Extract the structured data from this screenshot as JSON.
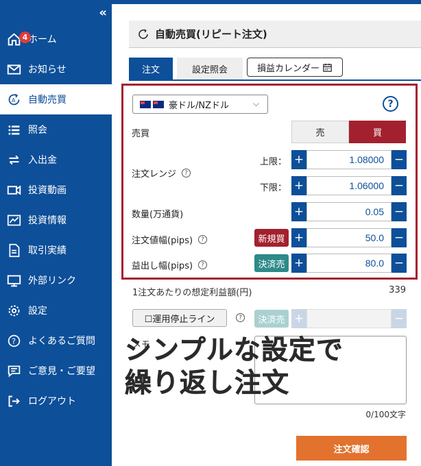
{
  "sidebar": {
    "collapse_label": "«",
    "items": [
      {
        "label": "ホーム",
        "icon": "home-icon"
      },
      {
        "label": "お知らせ",
        "icon": "mail-icon",
        "badge": "4"
      },
      {
        "label": "自動売買",
        "icon": "auto-trade-icon",
        "active": true
      },
      {
        "label": "照会",
        "icon": "list-icon"
      },
      {
        "label": "入出金",
        "icon": "transfer-icon"
      },
      {
        "label": "投資動画",
        "icon": "video-icon"
      },
      {
        "label": "投資情報",
        "icon": "chart-icon"
      },
      {
        "label": "取引実績",
        "icon": "document-icon"
      },
      {
        "label": "外部リンク",
        "icon": "monitor-icon"
      },
      {
        "label": "設定",
        "icon": "gear-icon"
      },
      {
        "label": "よくあるご質問",
        "icon": "question-icon"
      },
      {
        "label": "ご意見・ご要望",
        "icon": "comment-icon"
      },
      {
        "label": "ログアウト",
        "icon": "logout-icon"
      }
    ]
  },
  "header": {
    "title": "自動売買(リピート注文)"
  },
  "tabs": {
    "order": "注文",
    "settings": "設定照会",
    "calendar": "損益カレンダー"
  },
  "form": {
    "pair": "豪ドル/NZドル",
    "help": "?",
    "side_label": "売買",
    "sell": "売",
    "buy": "買",
    "range_label": "注文レンジ",
    "upper_label": "上限：",
    "upper_value": "1.08000",
    "lower_label": "下限：",
    "lower_value": "1.06000",
    "qty_label": "数量(万通貨)",
    "qty_value": "0.05",
    "width_label": "注文値幅(pips)",
    "width_tag": "新規買",
    "width_value": "50.0",
    "tp_label": "益出し幅(pips)",
    "tp_tag": "決済売",
    "tp_value": "80.0",
    "plus": "+",
    "minus": "−"
  },
  "profit": {
    "label": "1注文あたりの想定利益額(円)",
    "value": "339"
  },
  "stop": {
    "label": "☐運用停止ライン",
    "tag": "決済売"
  },
  "memo": {
    "label": "メモ",
    "count": "0/100文字"
  },
  "overlay": {
    "line1": "シンプルな設定で",
    "line2": "繰り返し注文"
  },
  "confirm_label": "注文確認"
}
